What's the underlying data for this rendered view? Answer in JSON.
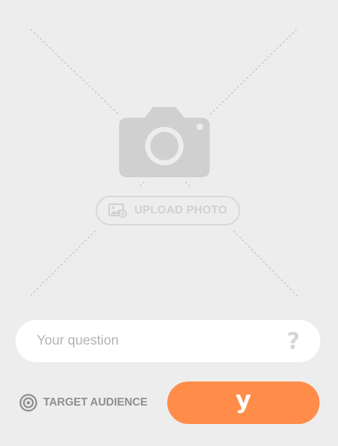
{
  "photo": {
    "upload_label": "UPLOAD PHOTO",
    "placeholder_icon": "camera-icon",
    "upload_icon": "image-add-icon"
  },
  "question": {
    "placeholder": "Your question",
    "value": "",
    "help_glyph": "?"
  },
  "footer": {
    "target_label": "TARGET AUDIENCE",
    "target_icon": "target-icon",
    "submit_label": "y"
  },
  "colors": {
    "background": "#ededed",
    "accent": "#ff8d49",
    "placeholder_gray": "#cfcfcf",
    "text_gray": "#8f8f8f"
  }
}
